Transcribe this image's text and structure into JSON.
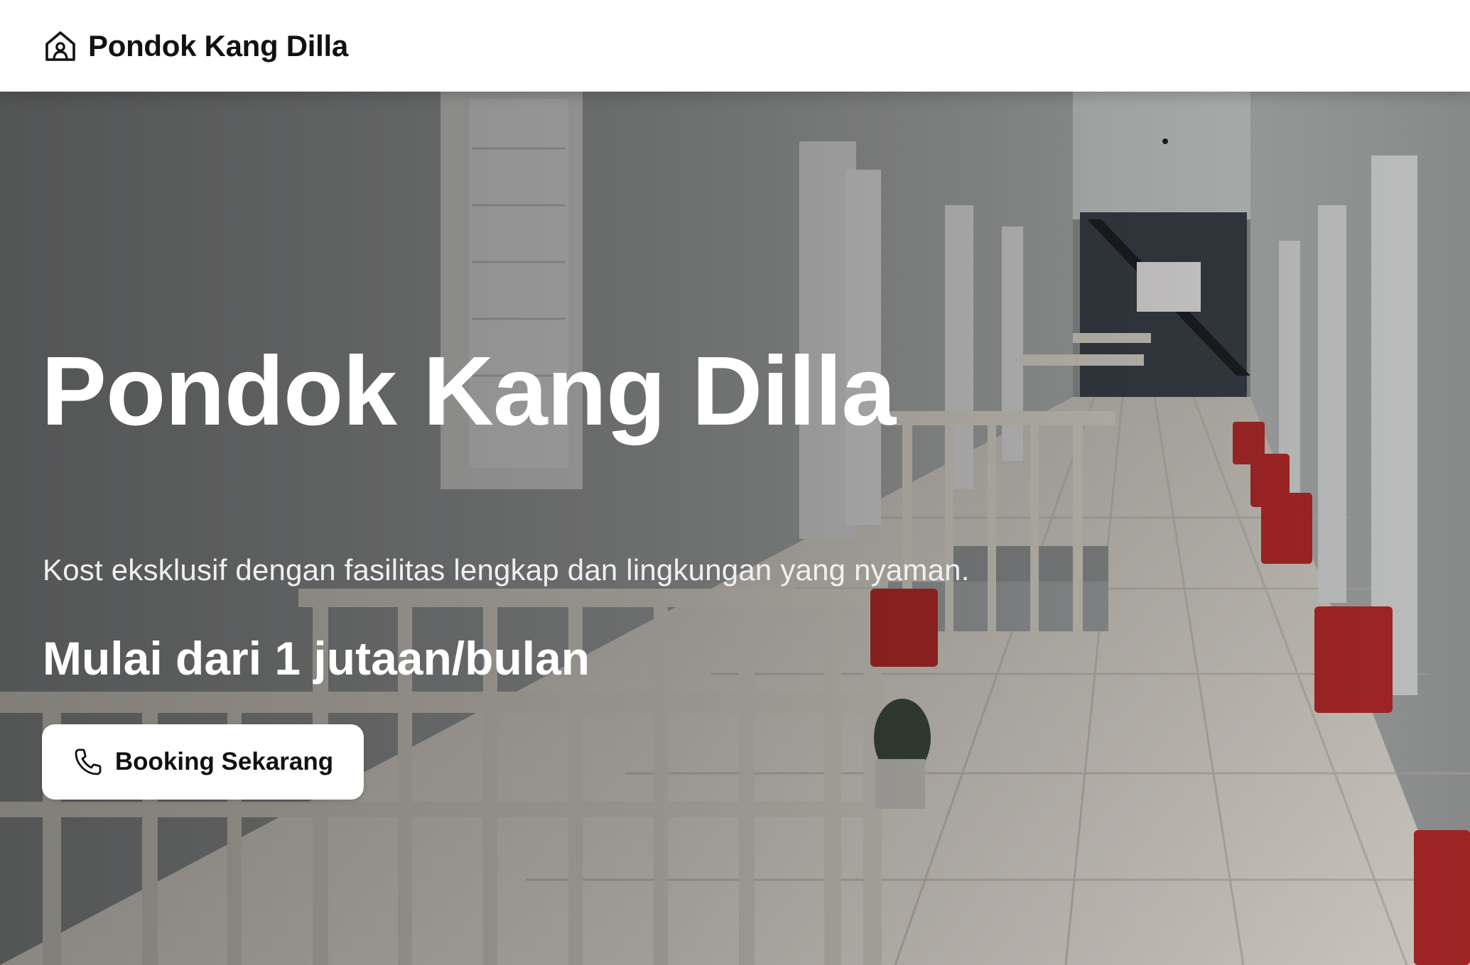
{
  "navbar": {
    "brand_icon": "home-icon",
    "brand_name": "Pondok Kang Dilla"
  },
  "hero": {
    "background_image": "kost-corridor-photo",
    "title": "Pondok Kang Dilla",
    "subtitle": "Kost eksklusif dengan fasilitas lengkap dan lingkungan yang nyaman.",
    "price": "Mulai dari 1 jutaan/bulan",
    "cta": {
      "icon": "phone-icon",
      "label": "Booking Sekarang"
    }
  },
  "colors": {
    "navbar_bg": "#ffffff",
    "text_dark": "#111111",
    "hero_text": "#ffffff",
    "bucket_red": "#b52a2a"
  }
}
